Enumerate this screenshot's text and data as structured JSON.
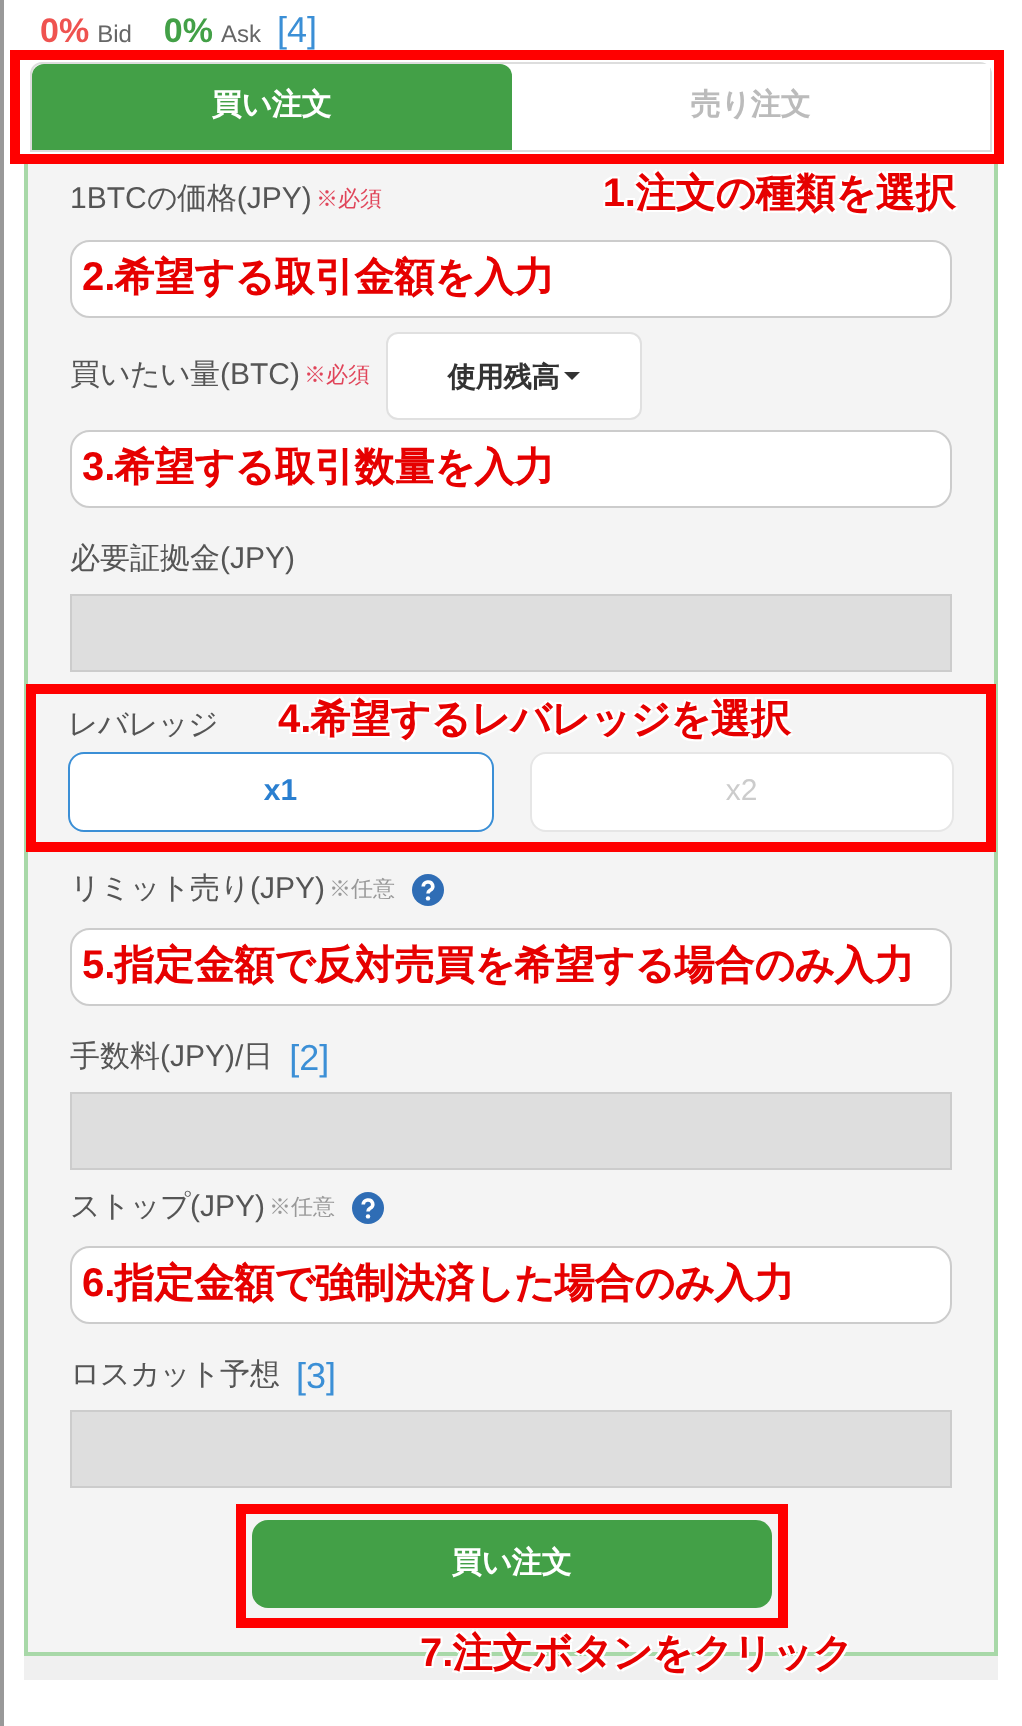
{
  "header": {
    "bid_value": "0%",
    "bid_label": "Bid",
    "ask_value": "0%",
    "ask_label": "Ask",
    "note": "[4]"
  },
  "tabs": [
    {
      "label": "買い注文",
      "selected": true
    },
    {
      "label": "売り注文",
      "selected": false
    }
  ],
  "tabs_annotation": "1.注文の種類を選択",
  "rows": [
    {
      "kind": "input",
      "label": "1BTCの価格(JPY)",
      "mark": {
        "text": "※必須",
        "kind": "required"
      },
      "annotation": "2.希望する取引金額を入力"
    },
    {
      "kind": "input",
      "label": "買いたい量(BTC)",
      "mark": {
        "text": "※必須",
        "kind": "required"
      },
      "dropdown": "使用残高",
      "annotation": "3.希望する取引数量を入力"
    },
    {
      "kind": "readonly",
      "label": "必要証拠金(JPY)"
    },
    {
      "kind": "leverage",
      "label": "レバレッジ",
      "annotation": "4.希望するレバレッジを選択",
      "options": [
        {
          "label": "x1",
          "selected": true
        },
        {
          "label": "x2",
          "selected": false
        }
      ]
    },
    {
      "kind": "input",
      "label": "リミット売り(JPY)",
      "mark": {
        "text": "※任意",
        "kind": "optional"
      },
      "help": true,
      "annotation": "5.指定金額で反対売買を希望する場合のみ入力"
    },
    {
      "kind": "readonly",
      "label": "手数料(JPY)/日",
      "note": "[2]"
    },
    {
      "kind": "input",
      "label": "ストップ(JPY)",
      "mark": {
        "text": "※任意",
        "kind": "optional"
      },
      "help": true,
      "annotation": "6.指定金額で強制決済した場合のみ入力"
    },
    {
      "kind": "readonly",
      "label": "ロスカット予想",
      "note": "[3]"
    }
  ],
  "submit": {
    "label": "買い注文",
    "annotation": "7.注文ボタンをクリック"
  }
}
